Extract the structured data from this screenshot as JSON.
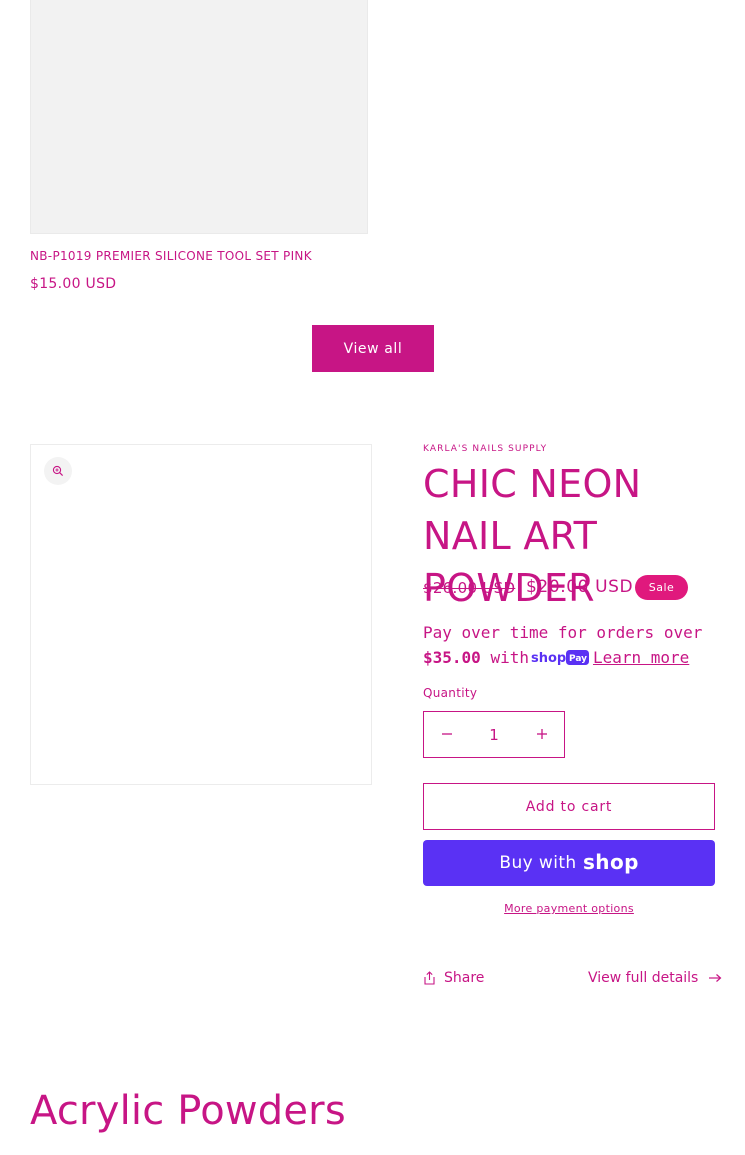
{
  "product_card": {
    "title": "NB-P1019 PREMIER SILICONE TOOL SET PINK",
    "price": "$15.00 USD"
  },
  "view_all_label": "View all",
  "product": {
    "vendor": "KARLA'S NAILS SUPPLY",
    "title": "CHIC NEON NAIL ART POWDER",
    "regular_price": "$26.00 USD",
    "sale_price": "$20.00 USD",
    "sale_badge": "Sale",
    "installments": {
      "prefix": "Pay over time for orders over",
      "amount": "$35.00",
      "with": "with",
      "learn_more": "Learn more"
    },
    "quantity_label": "Quantity",
    "quantity_value": "1",
    "add_to_cart_label": "Add to cart",
    "buy_with_label": "Buy with",
    "more_payment_options": "More payment options",
    "share_label": "Share",
    "view_full_details": "View full details"
  },
  "collection_heading": "Acrylic Powders",
  "icons": {
    "zoom": "zoom-icon",
    "minus": "minus-icon",
    "plus": "plus-icon",
    "share": "share-icon",
    "arrow": "arrow-right-icon",
    "shop_logo": "shop-logo",
    "shop_pay_logo": "shop-pay-logo"
  },
  "colors": {
    "accent": "#c71585",
    "sale_badge": "#e0197d",
    "shop_pay": "#5a31f4",
    "image_placeholder": "#f2f2f2"
  }
}
